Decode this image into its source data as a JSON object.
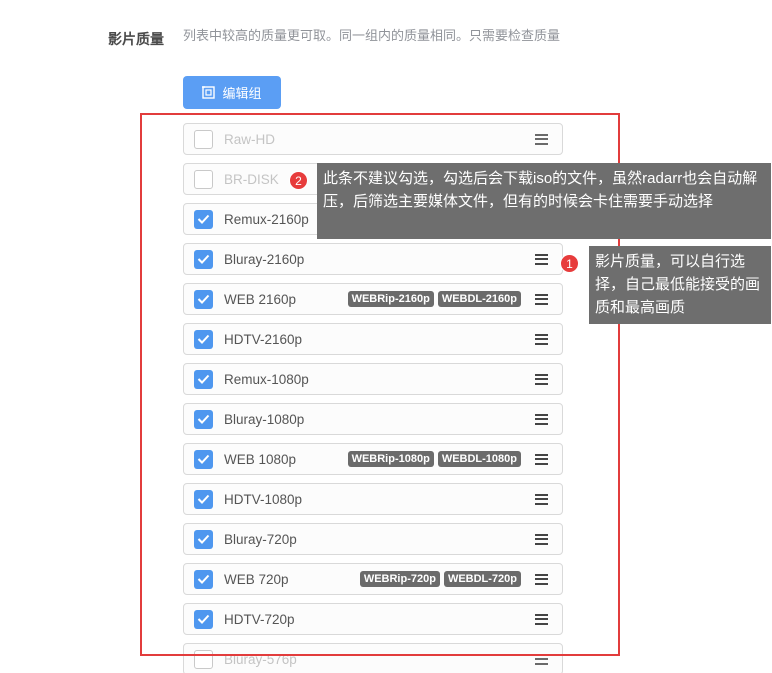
{
  "section": {
    "label": "影片质量",
    "help": "列表中较高的质量更可取。同一组内的质量相同。只需要检查质量"
  },
  "edit_button": {
    "label": "编辑组",
    "icon": "edit-group-icon"
  },
  "qualities": [
    {
      "name": "Raw-HD",
      "checked": false,
      "tags": []
    },
    {
      "name": "BR-DISK",
      "checked": false,
      "tags": []
    },
    {
      "name": "Remux-2160p",
      "checked": true,
      "tags": []
    },
    {
      "name": "Bluray-2160p",
      "checked": true,
      "tags": []
    },
    {
      "name": "WEB 2160p",
      "checked": true,
      "tags": [
        "WEBRip-2160p",
        "WEBDL-2160p"
      ]
    },
    {
      "name": "HDTV-2160p",
      "checked": true,
      "tags": []
    },
    {
      "name": "Remux-1080p",
      "checked": true,
      "tags": []
    },
    {
      "name": "Bluray-1080p",
      "checked": true,
      "tags": []
    },
    {
      "name": "WEB 1080p",
      "checked": true,
      "tags": [
        "WEBRip-1080p",
        "WEBDL-1080p"
      ]
    },
    {
      "name": "HDTV-1080p",
      "checked": true,
      "tags": []
    },
    {
      "name": "Bluray-720p",
      "checked": true,
      "tags": []
    },
    {
      "name": "WEB 720p",
      "checked": true,
      "tags": [
        "WEBRip-720p",
        "WEBDL-720p"
      ]
    },
    {
      "name": "HDTV-720p",
      "checked": true,
      "tags": []
    },
    {
      "name": "Bluray-576p",
      "checked": false,
      "tags": []
    }
  ],
  "annotations": {
    "note1": {
      "number": "1",
      "text": "影片质量，可以自行选择，自己最低能接受的画质和最高画质"
    },
    "note2": {
      "number": "2",
      "text": "此条不建议勾选，勾选后会下载iso的文件，虽然radarr也会自动解压，后筛选主要媒体文件，但有的时候会卡住需要手动选择"
    }
  },
  "colors": {
    "accent": "#5b9ef4",
    "checkbox": "#4e97ef",
    "highlight_frame": "#e23c3c",
    "badge": "#e73c3c",
    "callout_bg": "#6e6e6e",
    "tag_bg": "#6b6b6b"
  }
}
